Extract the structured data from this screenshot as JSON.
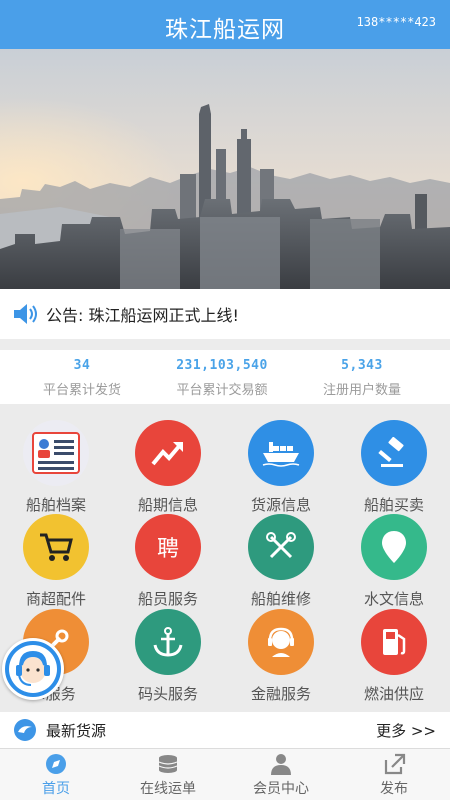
{
  "header": {
    "title": "珠江船运网",
    "user": "138*****423"
  },
  "notice": {
    "text": "公告: 珠江船运网正式上线!"
  },
  "stats": [
    {
      "value": "34",
      "label": "平台累计发货"
    },
    {
      "value": "231,103,540",
      "label": "平台累计交易额"
    },
    {
      "value": "5,343",
      "label": "注册用户数量"
    }
  ],
  "grid": [
    {
      "label": "船舶档案",
      "icon": "document-icon",
      "color": "#e9e9f1"
    },
    {
      "label": "船期信息",
      "icon": "trend-up-icon",
      "color": "#e8453b"
    },
    {
      "label": "货源信息",
      "icon": "cargo-ship-icon",
      "color": "#2f8fe5"
    },
    {
      "label": "船舶买卖",
      "icon": "gavel-icon",
      "color": "#2f8fe5"
    },
    {
      "label": "商超配件",
      "icon": "cart-icon",
      "color": "#f2c230"
    },
    {
      "label": "船员服务",
      "icon": "hire-icon",
      "glyph": "聘",
      "color": "#e8453b"
    },
    {
      "label": "船舶维修",
      "icon": "tools-icon",
      "color": "#2e9a7e"
    },
    {
      "label": "水文信息",
      "icon": "location-pin-icon",
      "color": "#35b98b"
    },
    {
      "label": "..服务",
      "icon": "wrench-icon",
      "color": "#ef8e36"
    },
    {
      "label": "码头服务",
      "icon": "anchor-icon",
      "color": "#2e9a7e"
    },
    {
      "label": "金融服务",
      "icon": "headset-person-icon",
      "color": "#ef8e36"
    },
    {
      "label": "燃油供应",
      "icon": "fuel-pump-icon",
      "color": "#e8453b"
    }
  ],
  "latest": {
    "title": "最新货源",
    "more": "更多 >>"
  },
  "tabs": [
    {
      "label": "首页",
      "icon": "compass-icon",
      "active": true
    },
    {
      "label": "在线运单",
      "icon": "coins-icon",
      "active": false
    },
    {
      "label": "会员中心",
      "icon": "user-icon",
      "active": false
    },
    {
      "label": "发布",
      "icon": "share-icon",
      "active": false
    }
  ],
  "colors": {
    "primary": "#4a9fe9",
    "stat_number": "#4aa3e8"
  }
}
